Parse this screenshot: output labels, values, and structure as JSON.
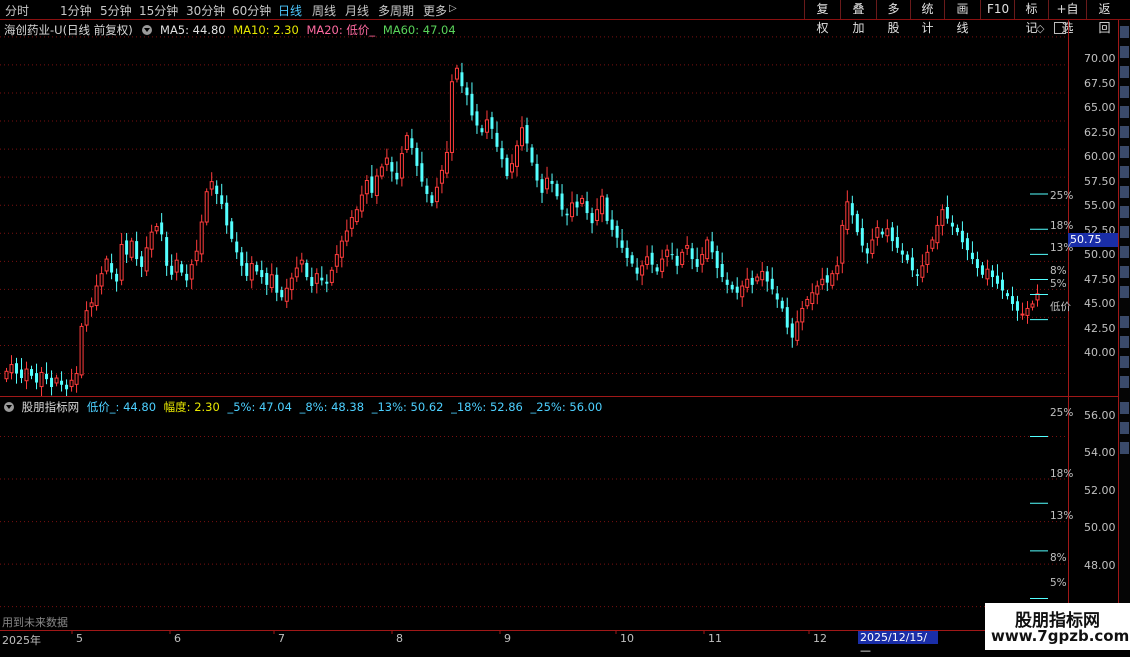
{
  "toolbar": {
    "periods": [
      "分时",
      "1分钟",
      "5分钟",
      "15分钟",
      "30分钟",
      "60分钟",
      "日线",
      "周线",
      "月线",
      "多周期",
      "更多"
    ],
    "active_period": "日线",
    "more_arrow": "▷",
    "buttons": [
      "复权",
      "叠加",
      "多股",
      "统计",
      "画线",
      "F10",
      "标记",
      "+自选",
      "返回"
    ]
  },
  "main_header": {
    "stock": "海创药业-U(日线 前复权)",
    "ma5": "MA5: 44.80",
    "ma10": "MA10: 2.30",
    "ma20": "MA20: 低价_",
    "ma60": "MA60: 47.04"
  },
  "main_axis": {
    "labels": [
      "70.00",
      "67.50",
      "65.00",
      "62.50",
      "60.00",
      "57.50",
      "55.00",
      "52.50",
      "50.00",
      "47.50",
      "45.00",
      "42.50",
      "40.00"
    ],
    "current_price": "50.75",
    "pct_labels": [
      "25%",
      "18%",
      "13%",
      "8%",
      "5%",
      "低价"
    ]
  },
  "indicator_header": {
    "name": "股朋指标网",
    "low": "低价_: 44.80",
    "amp": "幅度: 2.30",
    "p5": "_5%: 47.04",
    "p8": "_8%: 48.38",
    "p13": "_13%: 50.62",
    "p18": "_18%: 52.86",
    "p25": "_25%: 56.00"
  },
  "indicator_axis": {
    "labels": [
      "56.00",
      "54.00",
      "52.00",
      "50.00",
      "48.00"
    ],
    "pct_labels": [
      "25%",
      "18%",
      "13%",
      "8%",
      "5%"
    ]
  },
  "footer": {
    "future_note": "用到未来数据",
    "date_cursor": "2025/12/15/—",
    "x_labels": [
      "2025年",
      "5",
      "6",
      "7",
      "8",
      "9",
      "10",
      "11",
      "12"
    ]
  },
  "watermark": {
    "line1": "股朋指标网",
    "line2": "www.7gpzb.com"
  },
  "colors": {
    "up": "#ff3c3c",
    "down": "#54ffff",
    "grid": "#8a1010",
    "accent": "#4dc8ff"
  },
  "chart_data": {
    "type": "candlestick",
    "y_range": [
      38.0,
      71.5
    ],
    "closes": [
      40.2,
      40.8,
      40.0,
      39.6,
      40.4,
      39.8,
      39.2,
      40.1,
      39.5,
      38.8,
      39.6,
      39.0,
      38.6,
      39.4,
      40.0,
      44.2,
      45.6,
      46.3,
      47.8,
      48.9,
      50.2,
      49.0,
      48.2,
      51.5,
      50.6,
      51.8,
      50.2,
      49.5,
      51.2,
      52.6,
      53.1,
      52.4,
      49.6,
      48.8,
      50.1,
      49.0,
      48.3,
      49.7,
      50.9,
      53.5,
      56.2,
      57.1,
      56.0,
      55.1,
      53.2,
      52.0,
      50.8,
      49.6,
      48.7,
      49.8,
      49.1,
      48.6,
      47.9,
      48.8,
      47.2,
      46.8,
      47.6,
      48.5,
      49.4,
      50.1,
      48.6,
      47.8,
      48.9,
      48.3,
      48.0,
      49.2,
      50.6,
      51.8,
      52.7,
      53.9,
      54.6,
      55.9,
      57.2,
      56.1,
      57.6,
      58.4,
      59.2,
      58.0,
      57.3,
      59.6,
      61.2,
      60.1,
      58.5,
      57.1,
      56.0,
      55.2,
      56.6,
      58.1,
      59.7,
      66.0,
      67.2,
      65.6,
      64.8,
      63.0,
      62.1,
      61.5,
      62.6,
      61.8,
      60.2,
      59.1,
      57.6,
      58.7,
      60.3,
      61.9,
      60.5,
      58.8,
      57.2,
      56.1,
      57.4,
      56.9,
      55.8,
      54.6,
      54.1,
      55.2,
      54.8,
      55.6,
      54.3,
      53.4,
      54.6,
      55.8,
      53.6,
      52.8,
      52.1,
      51.2,
      50.3,
      49.8,
      48.9,
      49.6,
      50.4,
      49.7,
      49.1,
      50.2,
      51.0,
      50.6,
      49.6,
      50.8,
      51.4,
      50.2,
      49.5,
      50.6,
      51.9,
      50.8,
      49.4,
      48.6,
      47.9,
      47.5,
      47.2,
      47.8,
      48.4,
      47.9,
      48.6,
      49.1,
      48.2,
      47.5,
      46.6,
      45.8,
      44.1,
      43.2,
      44.6,
      45.8,
      46.6,
      47.2,
      47.8,
      48.4,
      48.1,
      48.9,
      49.6,
      53.2,
      55.3,
      54.1,
      52.6,
      51.4,
      50.7,
      51.9,
      53.0,
      52.4,
      52.9,
      51.8,
      51.2,
      50.6,
      50.1,
      49.2,
      48.7,
      49.6,
      50.8,
      51.9,
      53.2,
      54.6,
      53.8,
      53.1,
      52.6,
      51.7,
      51.0,
      50.2,
      49.4,
      48.8,
      49.3,
      48.6,
      48.0,
      47.4,
      46.9,
      46.2,
      45.6,
      45.3,
      45.8,
      46.2,
      47.1
    ]
  }
}
